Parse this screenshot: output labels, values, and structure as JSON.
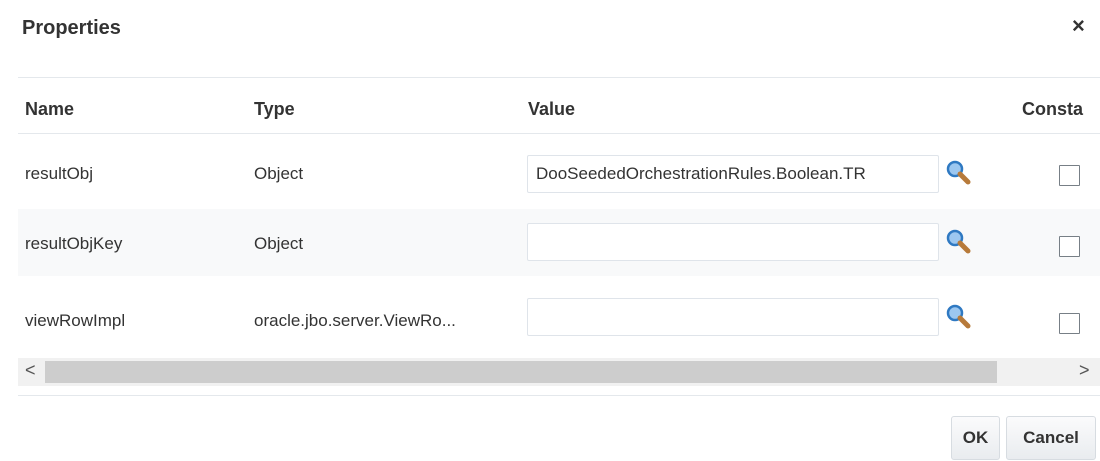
{
  "dialog": {
    "title": "Properties",
    "close_label": "×"
  },
  "table": {
    "headers": {
      "name": "Name",
      "type": "Type",
      "value": "Value",
      "constant": "Consta"
    },
    "rows": [
      {
        "name": "resultObj",
        "type": "Object",
        "value": "DooSeededOrchestrationRules.Boolean.TR",
        "constant": false
      },
      {
        "name": "resultObjKey",
        "type": "Object",
        "value": "",
        "constant": false
      },
      {
        "name": "viewRowImpl",
        "type": "oracle.jbo.server.ViewRo...",
        "value": "",
        "constant": false
      }
    ]
  },
  "scrollbar": {
    "left_arrow": "<",
    "right_arrow": ">"
  },
  "buttons": {
    "ok": "OK",
    "cancel": "Cancel"
  },
  "icons": {
    "search": "magnifier-icon",
    "close": "close-icon"
  },
  "colors": {
    "search_icon_lens": "#2f79c2",
    "search_icon_handle": "#b77a3a",
    "row_alt": "#f8f9fa"
  }
}
